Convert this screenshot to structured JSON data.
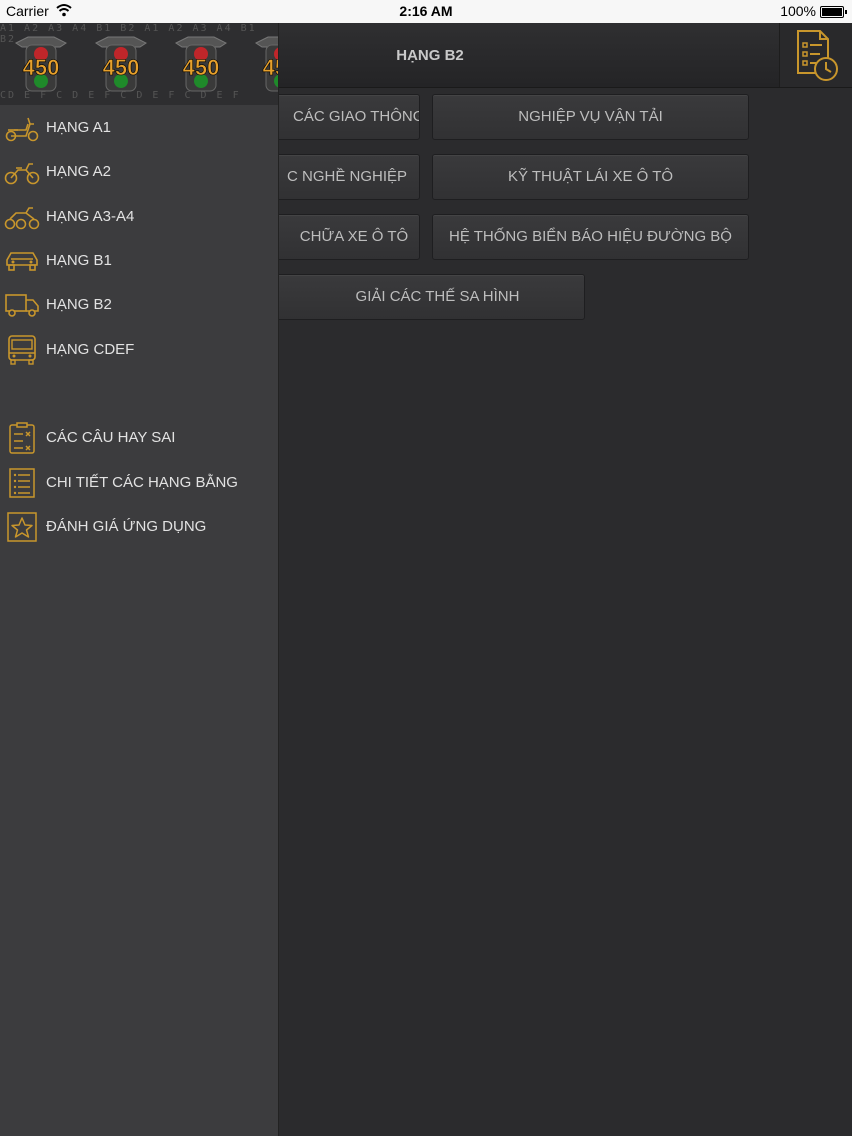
{
  "status_bar": {
    "carrier": "Carrier",
    "time": "2:16 AM",
    "battery": "100%"
  },
  "header": {
    "title": "HẠNG B2",
    "exam_icon": "exam-timer-icon"
  },
  "topics": [
    {
      "label": "CÁC GIAO THÔNG"
    },
    {
      "label": "NGHIỆP VỤ VẬN TẢI"
    },
    {
      "label": "C NGHỀ NGHIỆP"
    },
    {
      "label": "KỸ THUẬT LÁI XE Ô TÔ"
    },
    {
      "label": "CHỮA XE Ô TÔ"
    },
    {
      "label": "HỆ THỐNG BIỂN BÁO HIỆU ĐƯỜNG BỘ"
    },
    {
      "label": "GIẢI CÁC THẾ SA HÌNH"
    }
  ],
  "menu": {
    "banner": {
      "badge_text": "450",
      "bg_text_top": "A1 A2 A3 A4 B1 B2 A1 A2 A3 A4 B1 B2",
      "bg_text_bottom": "CD E F C D E F C D E F C D E F"
    },
    "license_items": [
      {
        "label": "HẠNG A1",
        "icon": "scooter-icon"
      },
      {
        "label": "HẠNG A2",
        "icon": "motorbike-icon"
      },
      {
        "label": "HẠNG A3-A4",
        "icon": "tricycle-icon"
      },
      {
        "label": "HẠNG B1",
        "icon": "car-icon"
      },
      {
        "label": "HẠNG B2",
        "icon": "truck-icon"
      },
      {
        "label": "HẠNG CDEF",
        "icon": "bus-icon"
      }
    ],
    "extra_items": [
      {
        "label": "CÁC CÂU HAY SAI",
        "icon": "clipboard-icon"
      },
      {
        "label": "CHI TIẾT CÁC HẠNG BẰNG",
        "icon": "list-icon"
      },
      {
        "label": "ĐÁNH GIÁ ỨNG DỤNG",
        "icon": "star-icon"
      }
    ]
  },
  "colors": {
    "accent": "#c8962c",
    "menu_bg": "#3c3c3e",
    "content_bg": "#2b2b2d"
  }
}
